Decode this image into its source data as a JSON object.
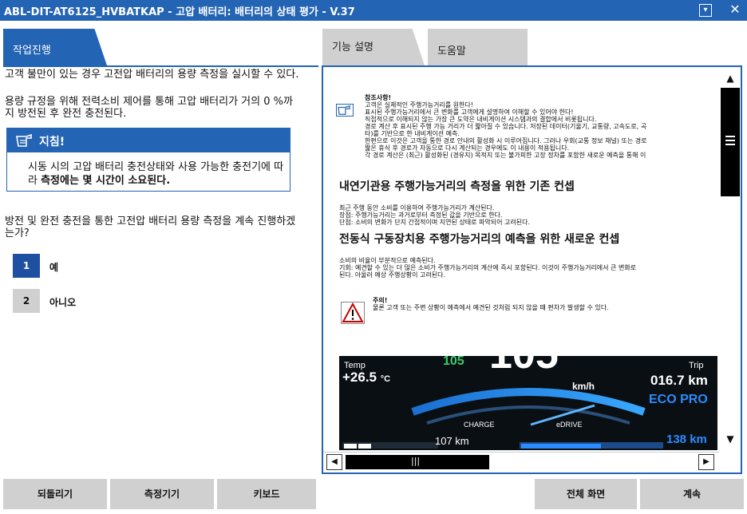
{
  "window": {
    "title": "ABL-DIT-AT6125_HVBATKAP - 고압 배터리: 배터리의 상태 평가 - V.37",
    "minimize_icon": "dropdown-box-icon",
    "close_icon": "close-icon"
  },
  "tabs": {
    "active": "작업진행",
    "feature": "기능 설명",
    "help": "도움말"
  },
  "left": {
    "para1": "고객 불만이 있는 경우 고전압 배터리의 용량 측정을 실시할 수 있다.",
    "para2": "용량 규정을 위해 전력소비 제어를 통해 고압 배터리가 거의 0 %까지 방전된 후 완전 충전된다.",
    "note_title": "지침!",
    "note_text_1": "시동 시의 고압 배터리 충전상태와 사용 가능한 충전기에 따라 ",
    "note_text_bold": "측정에는 몇 시간이 소요된다.",
    "question": "방전 및 완전 충전을 통한 고전압 배터리 용량 측정을 계속 진행하겠는가?",
    "options": [
      {
        "num": "1",
        "label": "예"
      },
      {
        "num": "2",
        "label": "아니오"
      }
    ]
  },
  "doc": {
    "ref_title": "참조사항!",
    "ref_lines": [
      "고객은 실제적인 주행가능거리를 원한다!",
      "표시된 주행가능거리에서 큰 변화를 고객에게 설명하여 이해할 수 있어야 한다!",
      "직접적으로 이해되지 않는 가장 큰 도약은 내비게이션 시스템과의 결합에서 비롯됩니다.",
      "경로 계산 후 표시된 주행 가능 거리가 더 짧아질 수 있습니다. 저장된 데이터(기울기, 교통량, 고속도로, 곡",
      "타)를 기반으로 한 내비게이션 예측.",
      "한편으로 이것은 고객을 통한 경로 안내의 활성화 시 이루어집니다. 그러나 우회(교통 정보 채널) 또는 경로",
      "짧은 휴식 후 경로가 자동으로 다시 계산되는 경우에도 이 내용이 적용됩니다.",
      "각 경로 계산은 (최근) 활성화된 (경유지) 목적지 또는 불가피한 고장 정차를 포함한 새로운 예측을 통해 이"
    ],
    "h_old": "내연기관용 주행가능거리의 측정을 위한 기존 컨셉",
    "old_lines": [
      "최근 주행 동안 소비를 이용하여 주행가능거리가 계산된다.",
      "장점: 주행가능거리는 과거로부터 측정된 값을 기반으로 한다.",
      "단점: 소비의 변화가 단지 간접적이며 지연된 상태로 파악되어 고려된다."
    ],
    "h_new": "전동식 구동장치용 주행가능거리의 예측을 위한 새로운 컨셉",
    "new_lines": [
      "소비의 비율이 부분적으로 예측된다.",
      "기회: 예견할 수 있는 더 많은 소비가 주행가능거리의 계산에 즉시 포함된다. 이것이 주행가능거리에서 큰 변화로",
      "된다. 아울러 예상 주행상황이 고려된다."
    ],
    "caution_title": "주의!",
    "caution_text": "물론 고객 또는 주변 상황이 예측에서 예견된 것처럼 되지 않을 때 편차가 발생할 수 있다."
  },
  "dashboard": {
    "temp_label": "Temp",
    "temp_value": "+26.5",
    "temp_unit": "°C",
    "small_speed": "105",
    "speed": "105",
    "speed_unit": "km/h",
    "trip_label": "Trip",
    "trip_value": "016.7 km",
    "mode": "ECO PRO",
    "charge_label": "CHARGE",
    "edrive_label": "eDRIVE",
    "range_left": "107 km",
    "range_right": "138 km"
  },
  "buttons": {
    "back": "되돌리기",
    "measure": "측정기기",
    "keyboard": "키보드",
    "fullscreen": "전체 화면",
    "continue": "계속"
  },
  "colors": {
    "accent": "#2464b4",
    "inactive": "#d0d0d0"
  }
}
